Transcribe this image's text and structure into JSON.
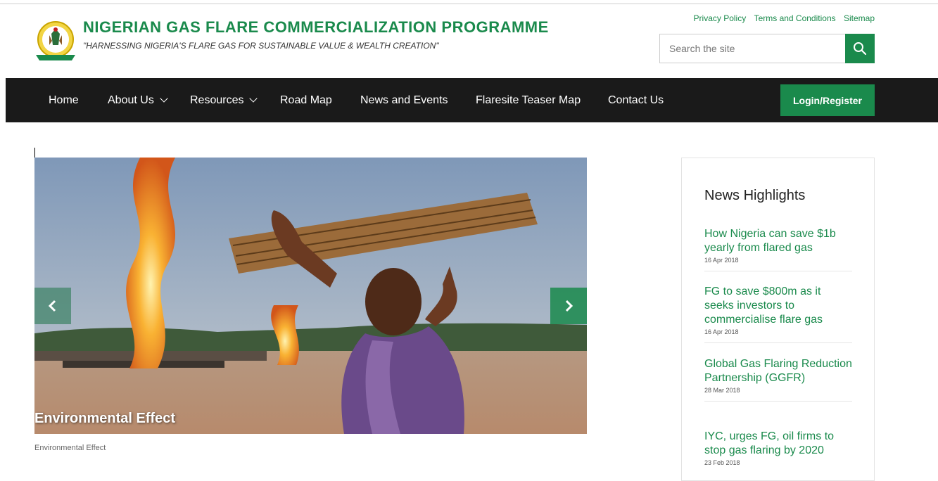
{
  "header": {
    "title": "NIGERIAN GAS FLARE COMMERCIALIZATION PROGRAMME",
    "tagline": "\"HARNESSING NIGERIA'S FLARE GAS FOR SUSTAINABLE VALUE & WEALTH CREATION\"",
    "links": [
      "Privacy Policy",
      "Terms and Conditions",
      "Sitemap"
    ],
    "search_placeholder": "Search the site"
  },
  "nav": {
    "items": [
      {
        "label": "Home"
      },
      {
        "label": "About Us"
      },
      {
        "label": "Resources"
      },
      {
        "label": "Road Map"
      },
      {
        "label": "News and Events"
      },
      {
        "label": "Flaresite Teaser Map"
      },
      {
        "label": "Contact Us"
      }
    ],
    "login_label": "Login/Register"
  },
  "slider": {
    "caption": "Environmental Effect",
    "below_caption": "Environmental Effect"
  },
  "news": {
    "title": "News Highlights",
    "items": [
      {
        "headline": "How Nigeria can save $1b yearly from flared gas",
        "date": "16 Apr 2018"
      },
      {
        "headline": "FG to save $800m as it seeks investors to commercialise flare gas",
        "date": "16 Apr 2018"
      },
      {
        "headline": "Global Gas Flaring Reduction Partnership (GGFR)",
        "date": "28 Mar 2018"
      },
      {
        "headline": "IYC, urges FG, oil firms to stop gas flaring by 2020",
        "date": "23 Feb 2018"
      }
    ]
  },
  "colors": {
    "brand_green": "#1a8a4c",
    "nav_bg": "#1a1a1a"
  }
}
